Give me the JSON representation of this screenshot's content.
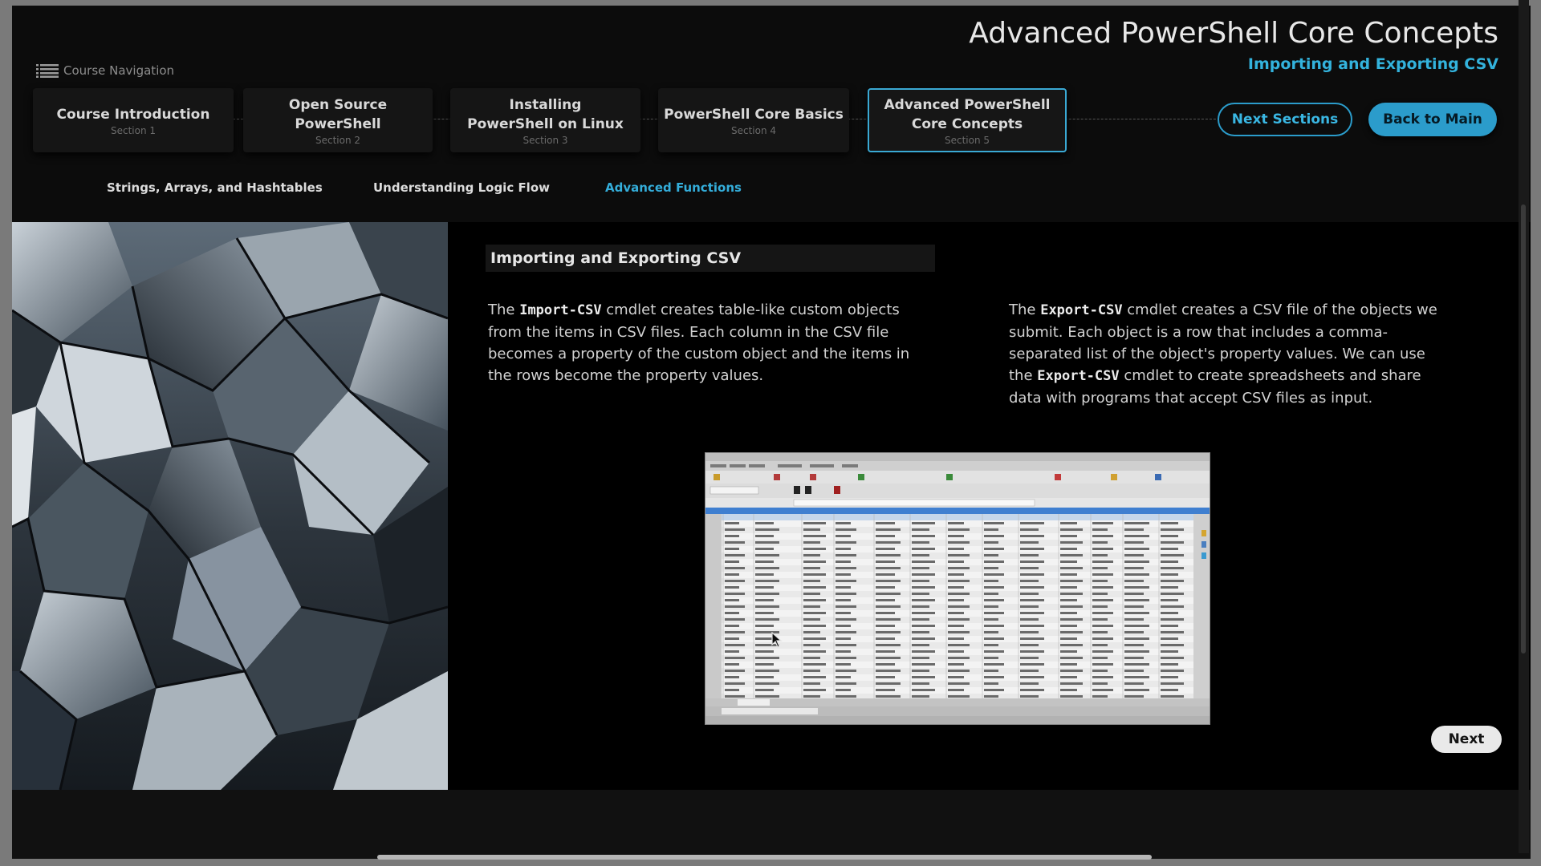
{
  "header": {
    "nav_label": "Course Navigation",
    "title": "Advanced PowerShell Core Concepts",
    "subtitle": "Importing and Exporting CSV"
  },
  "sections": [
    {
      "title": "Course Introduction",
      "number": "Section 1"
    },
    {
      "title": "Open Source PowerShell",
      "number": "Section 2"
    },
    {
      "title": "Installing PowerShell on Linux",
      "number": "Section 3"
    },
    {
      "title": "PowerShell Core Basics",
      "number": "Section 4"
    },
    {
      "title": "Advanced PowerShell Core Concepts",
      "number": "Section 5",
      "active": true
    }
  ],
  "buttons": {
    "next_sections": "Next Sections",
    "back_to_main": "Back to Main",
    "next": "Next"
  },
  "sub_tabs": [
    {
      "label": "Strings, Arrays, and Hashtables"
    },
    {
      "label": "Understanding Logic Flow"
    },
    {
      "label": "Advanced Functions",
      "active": true
    }
  ],
  "topic": {
    "heading": "Importing and Exporting CSV",
    "import": {
      "pre": "The ",
      "cmd": "Import-CSV",
      "post": " cmdlet creates table-like custom objects from the items in CSV files. Each column in the CSV file becomes a property of the custom object and the items in the rows become the property values."
    },
    "export": {
      "pre": "The ",
      "cmd": "Export-CSV",
      "mid": " cmdlet creates a CSV file of the objects we submit. Each object is a row that includes a comma-separated list of the object's property values. We can use the ",
      "cmd2": "Export-CSV",
      "post": " cmdlet to create spreadsheets and share data with programs that accept CSV files as input."
    }
  },
  "colors": {
    "accent": "#2b9ccb",
    "background": "#0c0c0c",
    "text": "#d2d2d2"
  },
  "icons": {
    "nav": "hamburger-list-icon",
    "cursor": "mouse-pointer-icon"
  }
}
